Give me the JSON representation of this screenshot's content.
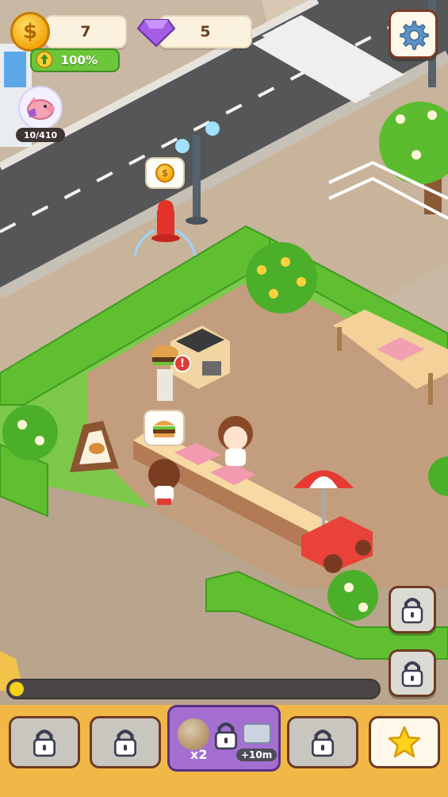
{
  "hud": {
    "coins": {
      "value": "7",
      "icon": "coin-icon"
    },
    "gems": {
      "value": "5",
      "icon": "gem-icon"
    },
    "boost": {
      "value": "100%"
    },
    "piggy_bank": {
      "value": "10/410",
      "icon": "piggy-bank-icon"
    },
    "settings": {
      "icon": "gear-icon"
    }
  },
  "scene": {
    "hydrant_bubble_icon": "coin-icon",
    "stand_order_icon": "burger-icon",
    "alert_icon": "exclamation-icon"
  },
  "progress": {
    "fraction": 0.03
  },
  "bottom_tabs": [
    {
      "icon": "lock-icon",
      "locked": true
    },
    {
      "icon": "lock-icon",
      "locked": true
    },
    {
      "icon": "lock-icon",
      "locked": true,
      "multiplier": "x2",
      "bonus": "+10m"
    },
    {
      "icon": "lock-icon",
      "locked": true
    },
    {
      "icon": "star-icon",
      "locked": false
    }
  ],
  "side_buttons": [
    {
      "icon": "lock-icon"
    },
    {
      "icon": "lock-icon"
    }
  ],
  "colors": {
    "bar": "#f2b847",
    "grass": "#6cc63a",
    "accent": "#9e5bd4"
  }
}
